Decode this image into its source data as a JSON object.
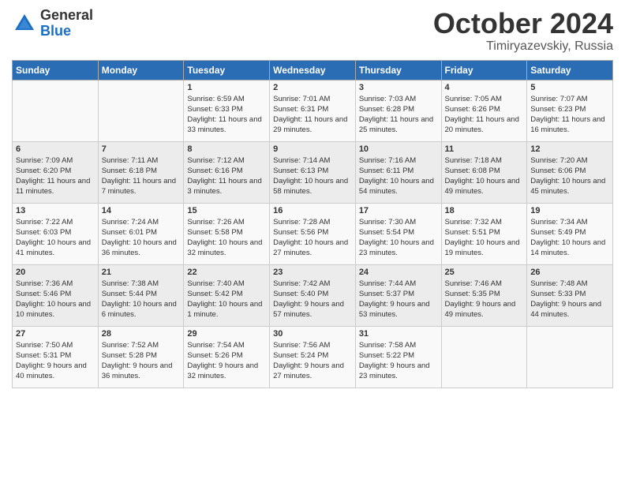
{
  "logo": {
    "general": "General",
    "blue": "Blue"
  },
  "title": "October 2024",
  "subtitle": "Timiryazevskiy, Russia",
  "days_of_week": [
    "Sunday",
    "Monday",
    "Tuesday",
    "Wednesday",
    "Thursday",
    "Friday",
    "Saturday"
  ],
  "weeks": [
    [
      {
        "day": "",
        "info": ""
      },
      {
        "day": "",
        "info": ""
      },
      {
        "day": "1",
        "info": "Sunrise: 6:59 AM\nSunset: 6:33 PM\nDaylight: 11 hours\nand 33 minutes."
      },
      {
        "day": "2",
        "info": "Sunrise: 7:01 AM\nSunset: 6:31 PM\nDaylight: 11 hours\nand 29 minutes."
      },
      {
        "day": "3",
        "info": "Sunrise: 7:03 AM\nSunset: 6:28 PM\nDaylight: 11 hours\nand 25 minutes."
      },
      {
        "day": "4",
        "info": "Sunrise: 7:05 AM\nSunset: 6:26 PM\nDaylight: 11 hours\nand 20 minutes."
      },
      {
        "day": "5",
        "info": "Sunrise: 7:07 AM\nSunset: 6:23 PM\nDaylight: 11 hours\nand 16 minutes."
      }
    ],
    [
      {
        "day": "6",
        "info": "Sunrise: 7:09 AM\nSunset: 6:20 PM\nDaylight: 11 hours\nand 11 minutes."
      },
      {
        "day": "7",
        "info": "Sunrise: 7:11 AM\nSunset: 6:18 PM\nDaylight: 11 hours\nand 7 minutes."
      },
      {
        "day": "8",
        "info": "Sunrise: 7:12 AM\nSunset: 6:16 PM\nDaylight: 11 hours\nand 3 minutes."
      },
      {
        "day": "9",
        "info": "Sunrise: 7:14 AM\nSunset: 6:13 PM\nDaylight: 10 hours\nand 58 minutes."
      },
      {
        "day": "10",
        "info": "Sunrise: 7:16 AM\nSunset: 6:11 PM\nDaylight: 10 hours\nand 54 minutes."
      },
      {
        "day": "11",
        "info": "Sunrise: 7:18 AM\nSunset: 6:08 PM\nDaylight: 10 hours\nand 49 minutes."
      },
      {
        "day": "12",
        "info": "Sunrise: 7:20 AM\nSunset: 6:06 PM\nDaylight: 10 hours\nand 45 minutes."
      }
    ],
    [
      {
        "day": "13",
        "info": "Sunrise: 7:22 AM\nSunset: 6:03 PM\nDaylight: 10 hours\nand 41 minutes."
      },
      {
        "day": "14",
        "info": "Sunrise: 7:24 AM\nSunset: 6:01 PM\nDaylight: 10 hours\nand 36 minutes."
      },
      {
        "day": "15",
        "info": "Sunrise: 7:26 AM\nSunset: 5:58 PM\nDaylight: 10 hours\nand 32 minutes."
      },
      {
        "day": "16",
        "info": "Sunrise: 7:28 AM\nSunset: 5:56 PM\nDaylight: 10 hours\nand 27 minutes."
      },
      {
        "day": "17",
        "info": "Sunrise: 7:30 AM\nSunset: 5:54 PM\nDaylight: 10 hours\nand 23 minutes."
      },
      {
        "day": "18",
        "info": "Sunrise: 7:32 AM\nSunset: 5:51 PM\nDaylight: 10 hours\nand 19 minutes."
      },
      {
        "day": "19",
        "info": "Sunrise: 7:34 AM\nSunset: 5:49 PM\nDaylight: 10 hours\nand 14 minutes."
      }
    ],
    [
      {
        "day": "20",
        "info": "Sunrise: 7:36 AM\nSunset: 5:46 PM\nDaylight: 10 hours\nand 10 minutes."
      },
      {
        "day": "21",
        "info": "Sunrise: 7:38 AM\nSunset: 5:44 PM\nDaylight: 10 hours\nand 6 minutes."
      },
      {
        "day": "22",
        "info": "Sunrise: 7:40 AM\nSunset: 5:42 PM\nDaylight: 10 hours\nand 1 minute."
      },
      {
        "day": "23",
        "info": "Sunrise: 7:42 AM\nSunset: 5:40 PM\nDaylight: 9 hours\nand 57 minutes."
      },
      {
        "day": "24",
        "info": "Sunrise: 7:44 AM\nSunset: 5:37 PM\nDaylight: 9 hours\nand 53 minutes."
      },
      {
        "day": "25",
        "info": "Sunrise: 7:46 AM\nSunset: 5:35 PM\nDaylight: 9 hours\nand 49 minutes."
      },
      {
        "day": "26",
        "info": "Sunrise: 7:48 AM\nSunset: 5:33 PM\nDaylight: 9 hours\nand 44 minutes."
      }
    ],
    [
      {
        "day": "27",
        "info": "Sunrise: 7:50 AM\nSunset: 5:31 PM\nDaylight: 9 hours\nand 40 minutes."
      },
      {
        "day": "28",
        "info": "Sunrise: 7:52 AM\nSunset: 5:28 PM\nDaylight: 9 hours\nand 36 minutes."
      },
      {
        "day": "29",
        "info": "Sunrise: 7:54 AM\nSunset: 5:26 PM\nDaylight: 9 hours\nand 32 minutes."
      },
      {
        "day": "30",
        "info": "Sunrise: 7:56 AM\nSunset: 5:24 PM\nDaylight: 9 hours\nand 27 minutes."
      },
      {
        "day": "31",
        "info": "Sunrise: 7:58 AM\nSunset: 5:22 PM\nDaylight: 9 hours\nand 23 minutes."
      },
      {
        "day": "",
        "info": ""
      },
      {
        "day": "",
        "info": ""
      }
    ]
  ]
}
